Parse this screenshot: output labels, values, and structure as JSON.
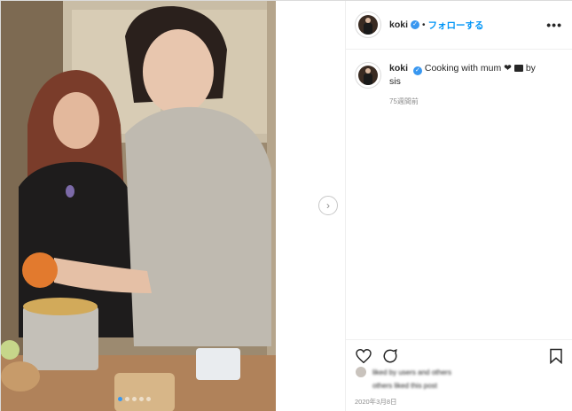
{
  "post": {
    "username": "koki",
    "follow_label": "フォローする",
    "separator": "•",
    "more_label": "•••",
    "verified_mark": "✓",
    "caption": {
      "username": "koki",
      "text": "Cooking with mum",
      "emoji_heart": "❤",
      "suffix": "by",
      "suffix2": "sis"
    },
    "time_ago": "75週間前",
    "likes_line1": "liked by users and others",
    "likes_line2": "others liked this post",
    "date": "2020年3月8日",
    "carousel": {
      "count": 5,
      "active_index": 0
    }
  },
  "icons": {
    "next": "chevron-right-icon",
    "like": "heart-icon",
    "comment": "comment-icon",
    "save": "bookmark-icon",
    "more": "more-icon",
    "verified": "verified-badge-icon"
  },
  "colors": {
    "accent": "#0095f6",
    "verified": "#3897f0",
    "meta": "#8e8e8e"
  }
}
